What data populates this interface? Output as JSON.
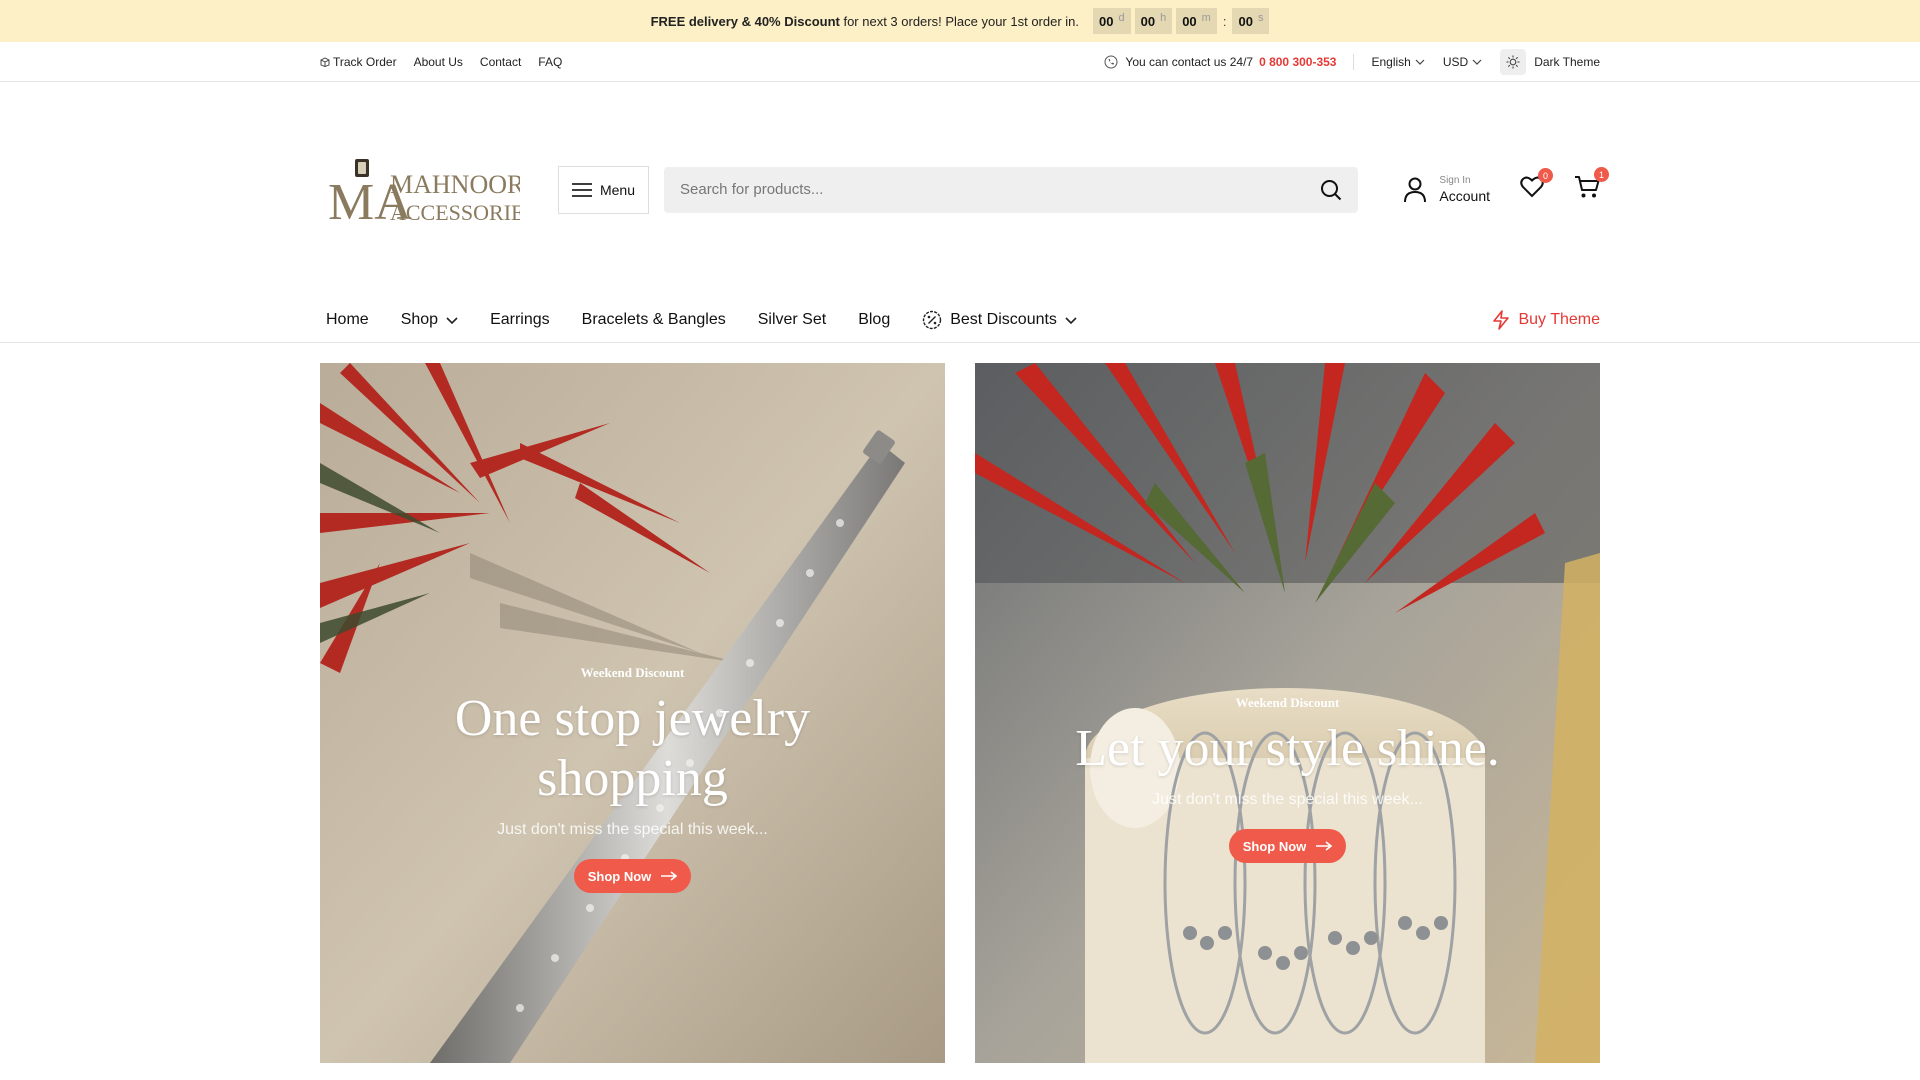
{
  "announcement": {
    "bold": "FREE delivery & 40% Discount",
    "rest": " for next 3 orders! Place your 1st order in.",
    "countdown": [
      {
        "value": "00",
        "unit": "d"
      },
      {
        "value": "00",
        "unit": "h"
      },
      {
        "value": "00",
        "unit": "m"
      },
      {
        "value": "00",
        "unit": "s"
      }
    ],
    "separator": ":"
  },
  "topbar": {
    "links": [
      "Track Order",
      "About Us",
      "Contact",
      "FAQ"
    ],
    "contact_text": "You can contact us 24/7",
    "phone": "0 800 300-353",
    "language": "English",
    "currency": "USD",
    "theme_label": "Dark Theme"
  },
  "header": {
    "logo_line1": "MAHNOOR",
    "logo_line2": "ACCESSORIES",
    "logo_mark": "MA",
    "menu_label": "Menu",
    "search_placeholder": "Search for products...",
    "account_small": "Sign In",
    "account_big": "Account",
    "wishlist_count": "0",
    "cart_count": "1"
  },
  "nav": {
    "items": [
      "Home",
      "Shop",
      "Earrings",
      "Bracelets & Bangles",
      "Silver Set",
      "Blog",
      "Best Discounts"
    ],
    "buy_theme": "Buy Theme"
  },
  "banners": [
    {
      "kicker": "Weekend Discount",
      "title": "One stop jewelry shopping",
      "subtitle": "Just don't miss the special this week...",
      "button": "Shop Now"
    },
    {
      "kicker": "Weekend Discount",
      "title": "Let your style shine.",
      "subtitle": "Just don't miss the special this week...",
      "button": "Shop Now"
    }
  ],
  "colors": {
    "accent": "#f05a4a",
    "announce_bg": "#fdf0c6",
    "phone": "#e53935"
  }
}
